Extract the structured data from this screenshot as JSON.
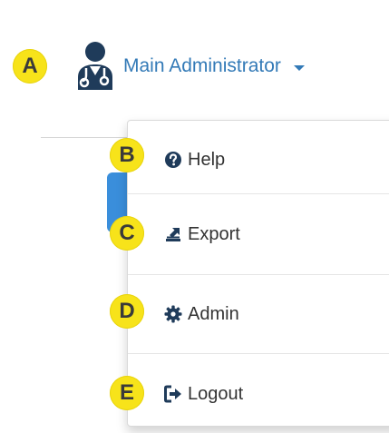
{
  "header": {
    "user_name": "Main Administrator",
    "user_icon": "doctor-user-icon",
    "caret_icon": "caret-down-icon"
  },
  "callouts": {
    "a": "A",
    "b": "B",
    "c": "C",
    "d": "D",
    "e": "E"
  },
  "menu": {
    "items": [
      {
        "label": "Help",
        "icon": "question-circle-icon"
      },
      {
        "label": "Export",
        "icon": "export-icon"
      },
      {
        "label": "Admin",
        "icon": "gear-icon"
      },
      {
        "label": "Logout",
        "icon": "sign-out-icon"
      }
    ]
  },
  "colors": {
    "link_blue": "#337ab7",
    "icon_navy": "#1f3b5a",
    "badge_yellow": "#f7e31a",
    "tab_blue": "#3a8edb"
  }
}
